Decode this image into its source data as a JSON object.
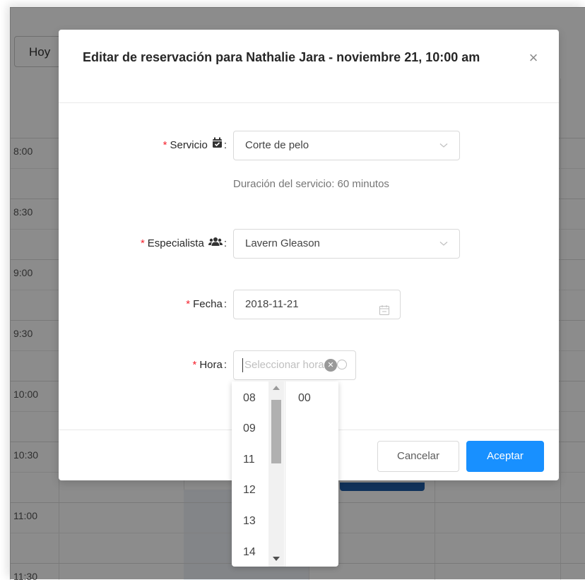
{
  "calendar": {
    "today_button": "Hoy",
    "time_slots": [
      "8:00",
      "8:30",
      "9:00",
      "9:30",
      "10:00",
      "10:30",
      "11:00",
      "11:30"
    ]
  },
  "modal": {
    "title": "Editar de reservación para Nathalie Jara - noviembre 21, 10:00 am",
    "close_icon": "close-icon",
    "colon": ":",
    "fields": {
      "service": {
        "label": "Servicio",
        "value": "Corte de pelo",
        "icon": "calendar-check-icon"
      },
      "service_duration": "Duración del servicio: 60 minutos",
      "specialist": {
        "label": "Especialista",
        "value": "Lavern Gleason",
        "icon": "users-icon"
      },
      "date": {
        "label": "Fecha",
        "value": "2018-11-21",
        "icon": "calendar-icon"
      },
      "time": {
        "label": "Hora",
        "placeholder": "Seleccionar hora",
        "icon": "clock-icon"
      }
    },
    "required_mark": "*",
    "buttons": {
      "cancel": "Cancelar",
      "ok": "Aceptar"
    }
  },
  "time_picker": {
    "hours": [
      "08",
      "09",
      "11",
      "12",
      "13",
      "14"
    ],
    "minutes": [
      "00"
    ]
  },
  "colors": {
    "primary": "#1890ff",
    "required": "#f5222d",
    "event": "#1f5da8"
  }
}
